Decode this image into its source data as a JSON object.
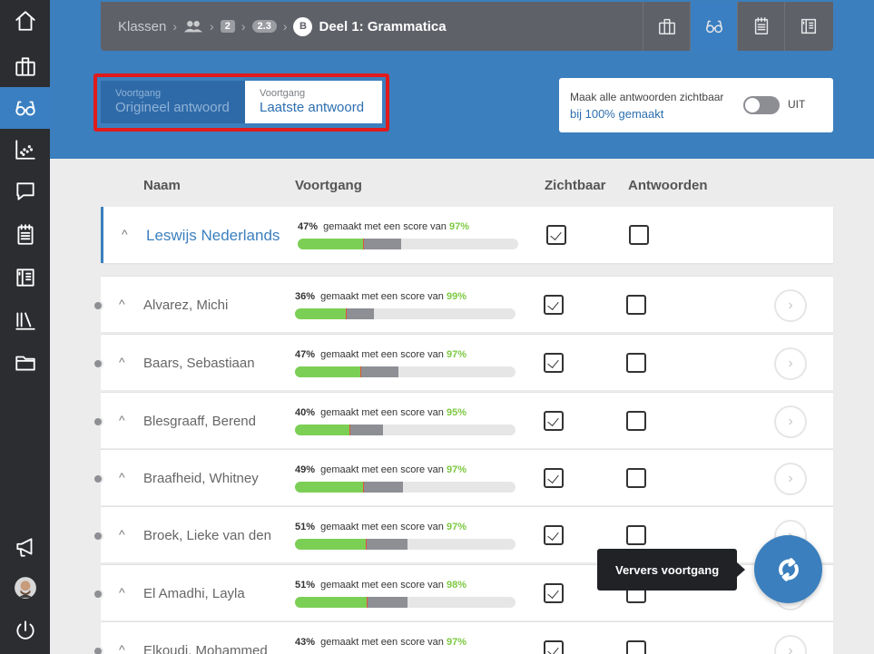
{
  "breadcrumb": {
    "root": "Klassen",
    "level_chip": "2",
    "sublevel_chip": "2.3",
    "section_badge": "B",
    "title": "Deel 1: Grammatica"
  },
  "toolbar_icons": [
    "briefcase-icon",
    "glasses-icon",
    "notepad-icon",
    "book-icon"
  ],
  "sidebar_icons": [
    "home-icon",
    "briefcase-icon",
    "glasses-icon",
    "scatter-chart-icon",
    "chat-icon",
    "notepad-icon",
    "book-icon",
    "library-icon",
    "folder-icon",
    "megaphone-icon",
    "avatar",
    "power-icon"
  ],
  "progress_toggle": {
    "option1_small": "Voortgang",
    "option1_label": "Origineel antwoord",
    "option2_small": "Voortgang",
    "option2_label": "Laatste antwoord"
  },
  "visibility": {
    "line1": "Maak alle antwoorden zichtbaar",
    "line2": "bij 100% gemaakt",
    "switch_label": "UIT"
  },
  "table": {
    "headers": [
      "Naam",
      "Voortgang",
      "Zichtbaar",
      "Antwoorden"
    ],
    "phrase": "gemaakt met een score van",
    "group": {
      "name": "Leswijs Nederlands",
      "pct": "47%",
      "score": "97%",
      "made": 0.47,
      "zichtbaar": true,
      "antwoorden": false
    },
    "rows": [
      {
        "name": "Alvarez, Michi",
        "pct": "36%",
        "score": "99%",
        "made": 0.36,
        "zichtbaar": true,
        "antwoorden": false
      },
      {
        "name": "Baars, Sebastiaan",
        "pct": "47%",
        "score": "97%",
        "made": 0.47,
        "zichtbaar": true,
        "antwoorden": false
      },
      {
        "name": "Blesgraaff, Berend",
        "pct": "40%",
        "score": "95%",
        "made": 0.4,
        "zichtbaar": true,
        "antwoorden": false
      },
      {
        "name": "Braafheid, Whitney",
        "pct": "49%",
        "score": "97%",
        "made": 0.49,
        "zichtbaar": true,
        "antwoorden": false
      },
      {
        "name": "Broek, Lieke van den",
        "pct": "51%",
        "score": "97%",
        "made": 0.51,
        "zichtbaar": true,
        "antwoorden": false
      },
      {
        "name": "El Amadhi, Layla",
        "pct": "51%",
        "score": "98%",
        "made": 0.51,
        "zichtbaar": true,
        "antwoorden": false
      },
      {
        "name": "Elkoudi, Mohammed",
        "pct": "43%",
        "score": "97%",
        "made": 0.43,
        "zichtbaar": true,
        "antwoorden": false
      }
    ]
  },
  "refresh": {
    "tooltip": "Ververs voortgang"
  },
  "colors": {
    "primary": "#3b7fbe",
    "score": "#7ec943",
    "highlight": "#e01b1b"
  }
}
